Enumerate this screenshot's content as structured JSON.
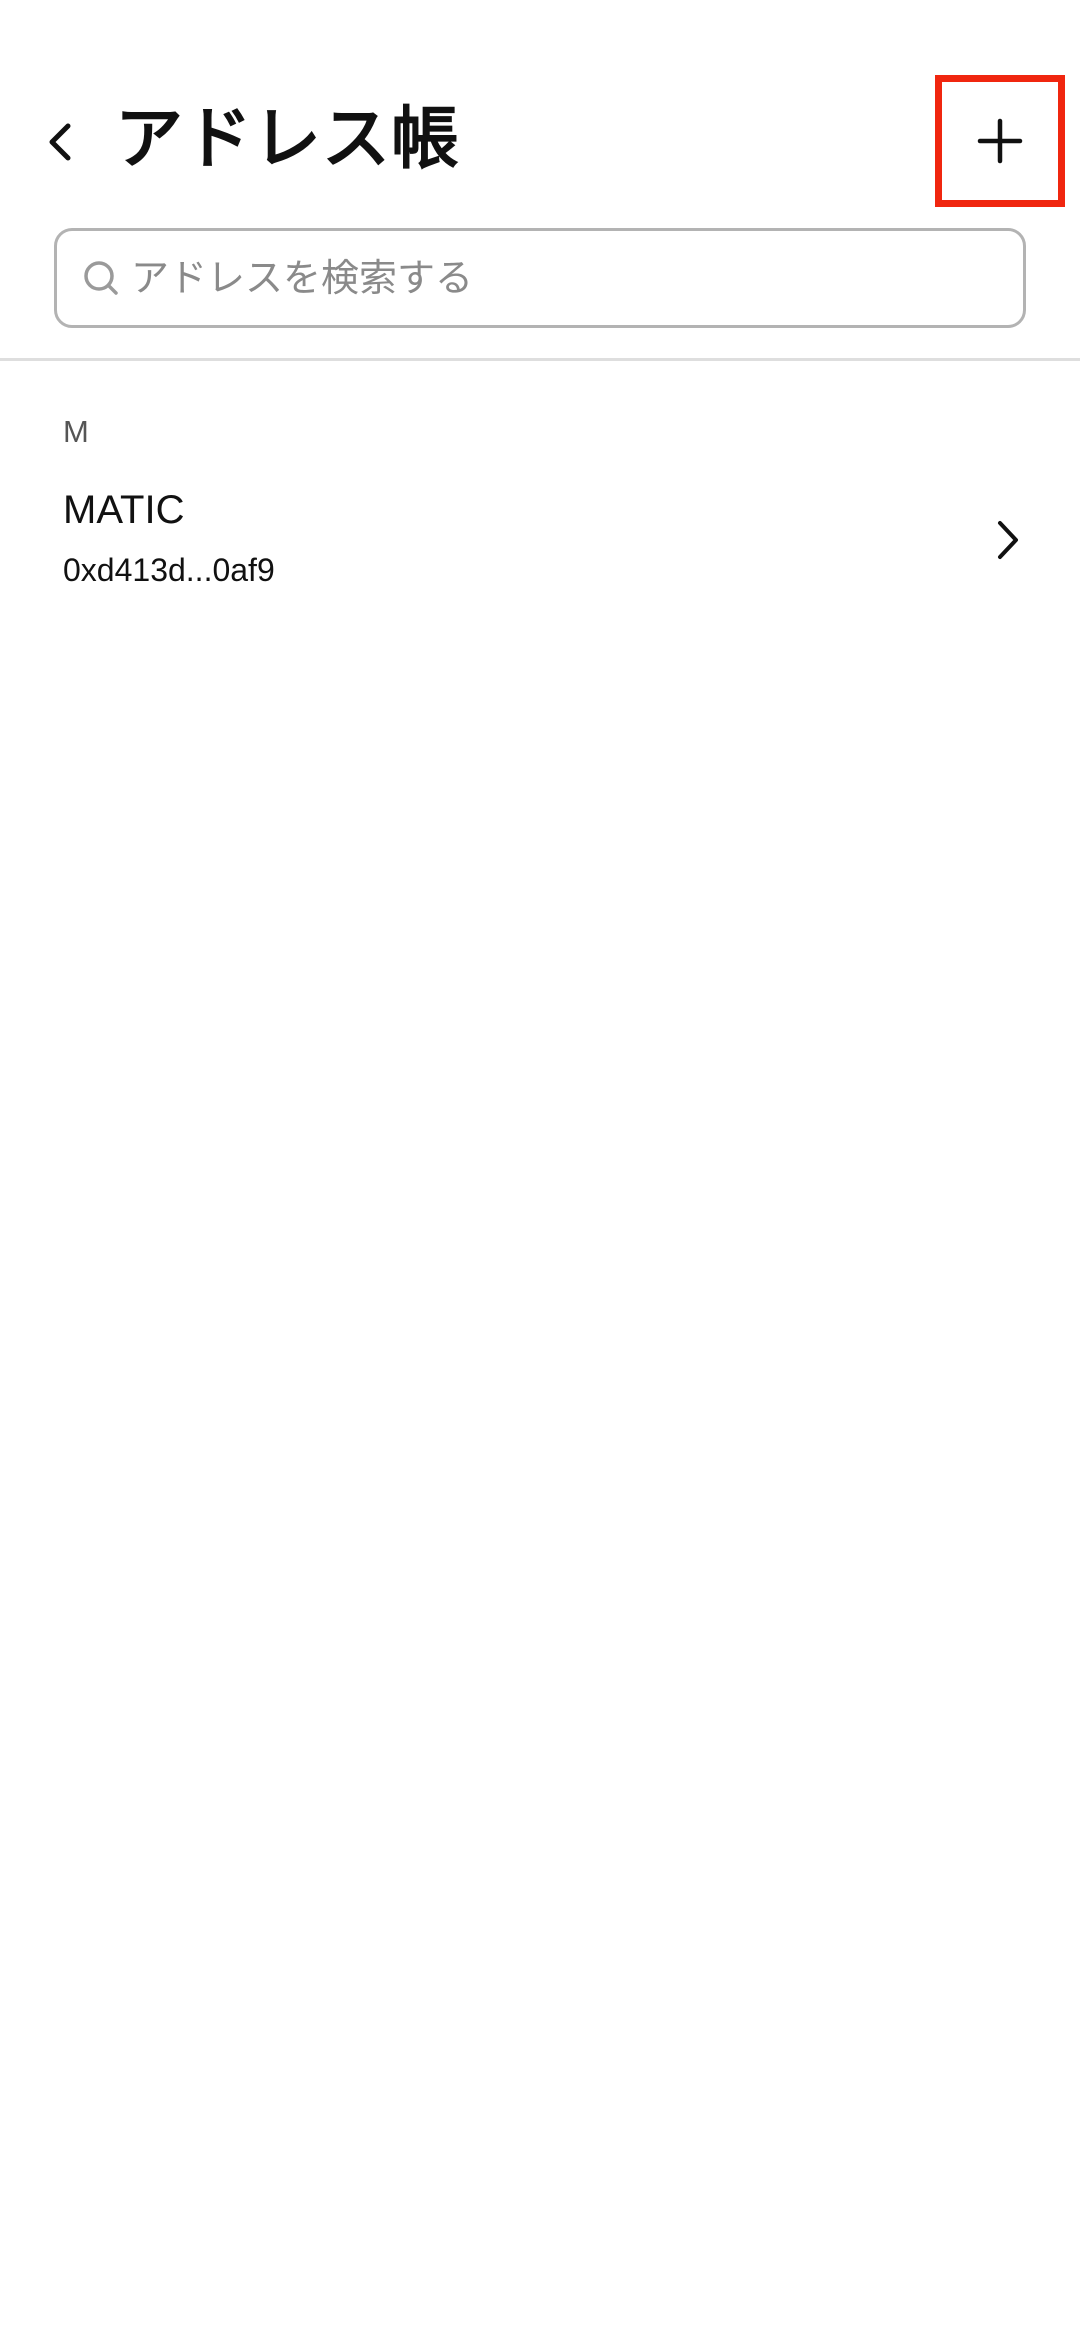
{
  "header": {
    "title": "アドレス帳",
    "back_icon": "chevron-left-icon",
    "add_icon": "plus-icon",
    "highlight_color": "#f0260f"
  },
  "search": {
    "placeholder": "アドレスを検索する",
    "value": "",
    "icon": "search-icon"
  },
  "sections": [
    {
      "letter": "M",
      "items": [
        {
          "name": "MATIC",
          "address": "0xd413d...0af9",
          "icon": "chevron-right-icon"
        }
      ]
    }
  ]
}
